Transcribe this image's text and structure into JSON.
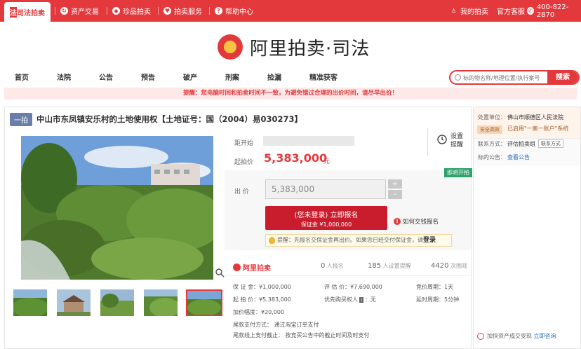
{
  "topbar": {
    "tabs": [
      "司法拍卖",
      "资产交易",
      "珍品拍卖",
      "拍卖服务",
      "帮助中心"
    ],
    "my_auction": "我的拍卖",
    "service": "官方客服",
    "phone": "400-822-2870"
  },
  "logo": {
    "text": "阿里拍卖·司法"
  },
  "nav": [
    "首页",
    "法院",
    "公告",
    "预告",
    "破产",
    "刑案",
    "捡漏",
    "精准获客"
  ],
  "search": {
    "placeholder": "标的物名称/地理位置/执行案号",
    "button": "搜索"
  },
  "notice": "提醒：您电脑时间和拍卖时间不一致，为避免错过合理的出价时间，请尽早出价！",
  "item": {
    "badge": "一拍",
    "title": "中山市东凤镇安乐村的土地使用权【土地证号：国（2004）易030273】",
    "countdown_label": "距开始",
    "start_price_label": "起拍价",
    "start_price": "5,383,000",
    "price_unit": "元",
    "remind_l1": "设置",
    "remind_l2": "提醒",
    "live_tag": "即将开拍",
    "bid_label": "出  价",
    "bid_value": "5,383,000",
    "plus": "+",
    "minus": "-",
    "signup_l1": "(您未登录) 立即报名",
    "signup_l2": "保证金 ¥1,000,000",
    "howto": "如何交钱报名",
    "tip_prefix": "提醒：先报名交保证金再出价。如果您已经交付保证金，请",
    "tip_login": "登录"
  },
  "stats": {
    "brand": "阿里拍卖",
    "signup_count": "0",
    "signup_label": "人报名",
    "remind_count": "185",
    "remind_label": "人设置提醒",
    "view_count": "4420",
    "view_label": "次围观"
  },
  "details": {
    "deposit": "保 证 金：¥1,000,000",
    "appraisal": "评 估 价：¥7,690,000",
    "bid_cycle": "竞价周期：1天",
    "start": "起 拍 价：¥5,383,000",
    "priority": "优先购买权人",
    "priority_val": "：无",
    "extend": "延时周期：5分钟",
    "increment": "加价幅度：¥20,000",
    "payment": "尾款支付方式：  通过淘宝订单支付",
    "deadline": "尾款线上支付截止：  按竞买公告中的截止时间及时支付"
  },
  "side": {
    "org_label": "处置单位：",
    "org": "佛山市顺德区人民法院",
    "safe": "安全高效",
    "system": "已启用\"一案一账户\"系统",
    "contact_label": "联系方式：",
    "contact": "评估拍卖组",
    "contact_btn": "联系方式",
    "notice_label": "标的公告：",
    "notice_link": "查看公告",
    "help": "加快资产成交变现",
    "help_link": "立即咨询"
  }
}
